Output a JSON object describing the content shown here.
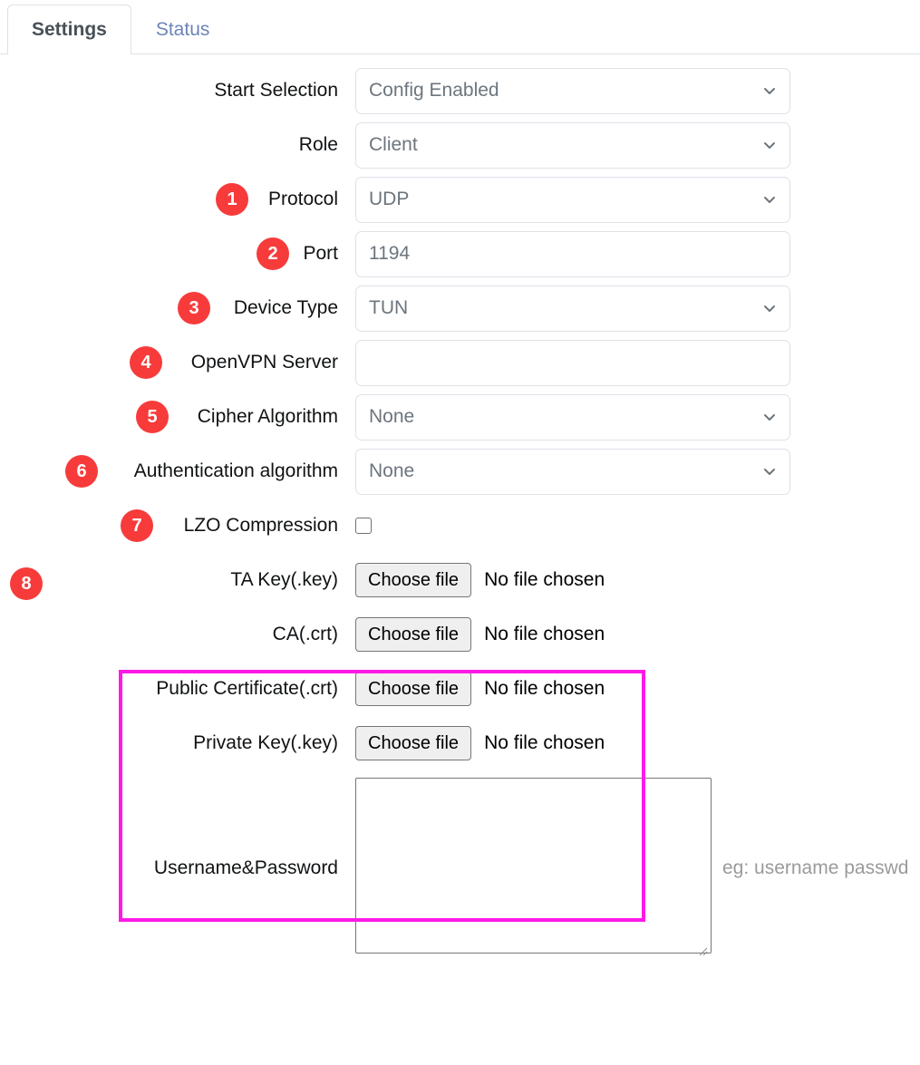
{
  "tabs": [
    {
      "label": "Settings",
      "active": true
    },
    {
      "label": "Status",
      "active": false
    }
  ],
  "colors": {
    "badge_red": "#f73b3b",
    "highlight_magenta": "#ff1ae6",
    "active_tab_text": "#495057",
    "inactive_tab_text": "#6c84b8",
    "field_text": "#6c757d"
  },
  "form": {
    "rows": [
      {
        "badge": "",
        "label": "Start Selection",
        "control": "select",
        "value": "Config Enabled"
      },
      {
        "badge": "",
        "label": "Role",
        "control": "select",
        "value": "Client"
      },
      {
        "badge": "1",
        "label": "Protocol",
        "control": "select",
        "value": "UDP"
      },
      {
        "badge": "2",
        "label": "Port",
        "control": "text",
        "value": "1194"
      },
      {
        "badge": "3",
        "label": "Device Type",
        "control": "select",
        "value": "TUN"
      },
      {
        "badge": "4",
        "label": "OpenVPN Server",
        "control": "text",
        "value": ""
      },
      {
        "badge": "5",
        "label": "Cipher Algorithm",
        "control": "select",
        "value": "None"
      },
      {
        "badge": "6",
        "label": "Authentication algorithm",
        "control": "select",
        "value": "None"
      },
      {
        "badge": "7",
        "label": "LZO Compression",
        "control": "checkbox",
        "value": ""
      }
    ],
    "file_section": {
      "badge": "8",
      "button_label": "Choose file",
      "no_file_text": "No file chosen",
      "rows": [
        {
          "label": "TA Key(.key)"
        },
        {
          "label": "CA(.crt)"
        },
        {
          "label": "Public Certificate(.crt)"
        },
        {
          "label": "Private Key(.key)"
        }
      ]
    },
    "password_row": {
      "label": "Username&Password",
      "value": "",
      "hint": "eg: username passwd"
    }
  },
  "icons": {
    "chevron_down": "chevron-down-icon",
    "resize_handle": "resize-handle-icon"
  }
}
